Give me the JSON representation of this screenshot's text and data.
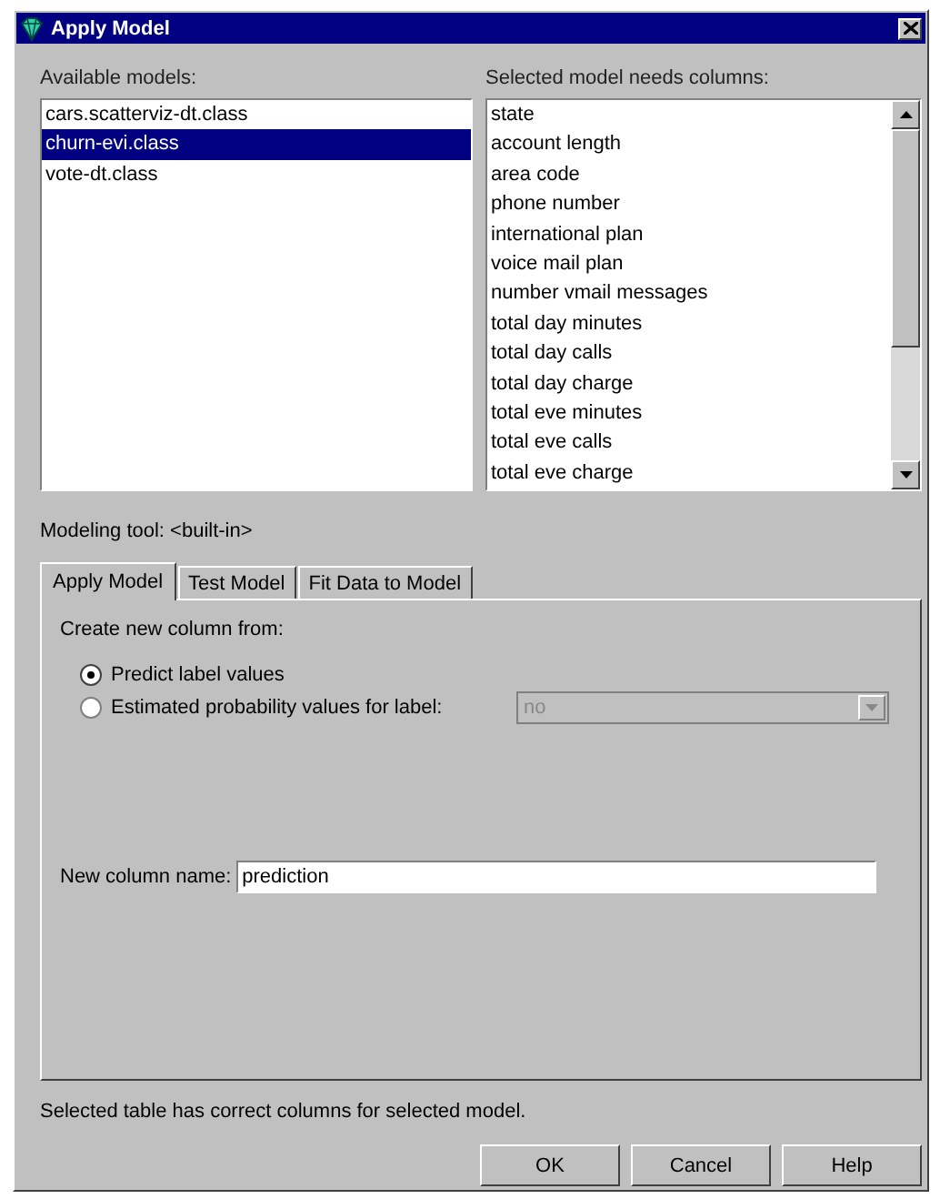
{
  "window": {
    "title": "Apply Model"
  },
  "available_models": {
    "label": "Available models:",
    "items": [
      {
        "text": "cars.scatterviz-dt.class",
        "selected": false
      },
      {
        "text": "churn-evi.class",
        "selected": true
      },
      {
        "text": "vote-dt.class",
        "selected": false
      }
    ]
  },
  "needed_columns": {
    "label": "Selected model needs columns:",
    "items": [
      "state",
      "account length",
      "area code",
      "phone number",
      "international plan",
      "voice mail plan",
      "number vmail messages",
      "total day minutes",
      "total day calls",
      "total day charge",
      "total eve minutes",
      "total eve calls",
      "total eve charge"
    ]
  },
  "modeling_tool": "Modeling tool: <built-in>",
  "tabs": [
    {
      "label": "Apply Model",
      "selected": true
    },
    {
      "label": "Test Model",
      "selected": false
    },
    {
      "label": "Fit Data to Model",
      "selected": false
    }
  ],
  "panel": {
    "heading": "Create new column from:",
    "options": [
      {
        "label": "Predict label values",
        "selected": true
      },
      {
        "label": "Estimated probability values for label:",
        "selected": false
      }
    ],
    "label_dropdown": {
      "value": "no",
      "disabled": true
    },
    "column_name": {
      "label": "New column name:",
      "value": "prediction"
    }
  },
  "status": "Selected table has correct columns for selected model.",
  "buttons": [
    "OK",
    "Cancel",
    "Help"
  ]
}
